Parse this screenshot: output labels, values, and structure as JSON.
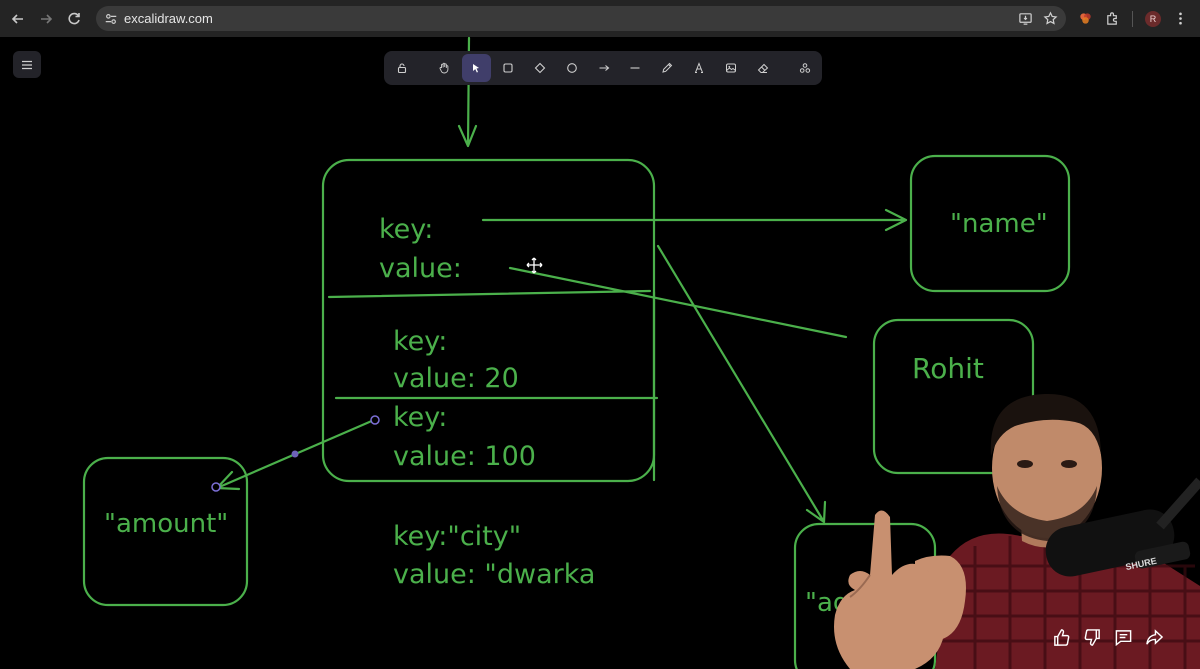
{
  "browser": {
    "url": "excalidraw.com",
    "profile_initial": "R",
    "icons": [
      "back-arrow-icon",
      "forward-arrow-icon",
      "reload-icon",
      "site-info-icon",
      "install-app-icon",
      "bookmark-star-icon",
      "extension-puzzle-icon",
      "menu-dots-icon"
    ]
  },
  "toolbar": {
    "tools": [
      "lock",
      "hand",
      "selection",
      "rectangle",
      "diamond",
      "ellipse",
      "arrow",
      "line",
      "draw",
      "text",
      "image",
      "eraser",
      "more-tools"
    ],
    "active_tool": "selection"
  },
  "canvas": {
    "stroke_color": "#4bb04b",
    "background": "#000000",
    "main_box": {
      "entries": [
        {
          "key_label": "key:",
          "value_label": "value:"
        },
        {
          "key_label": "key:",
          "value_label": "value: 20"
        },
        {
          "key_label": "key:",
          "value_label": "value: 100"
        }
      ]
    },
    "loose_text": {
      "key_label": "key:\"city\"",
      "value_label": "value: \"dwarka"
    },
    "boxes": {
      "name": "\"name\"",
      "rohit": "Rohit",
      "amount": "\"amount\"",
      "age": "\"ag"
    }
  },
  "video": {
    "actions": [
      "like-icon",
      "dislike-icon",
      "comment-icon",
      "share-icon"
    ],
    "mic_brand": "SHURE"
  }
}
